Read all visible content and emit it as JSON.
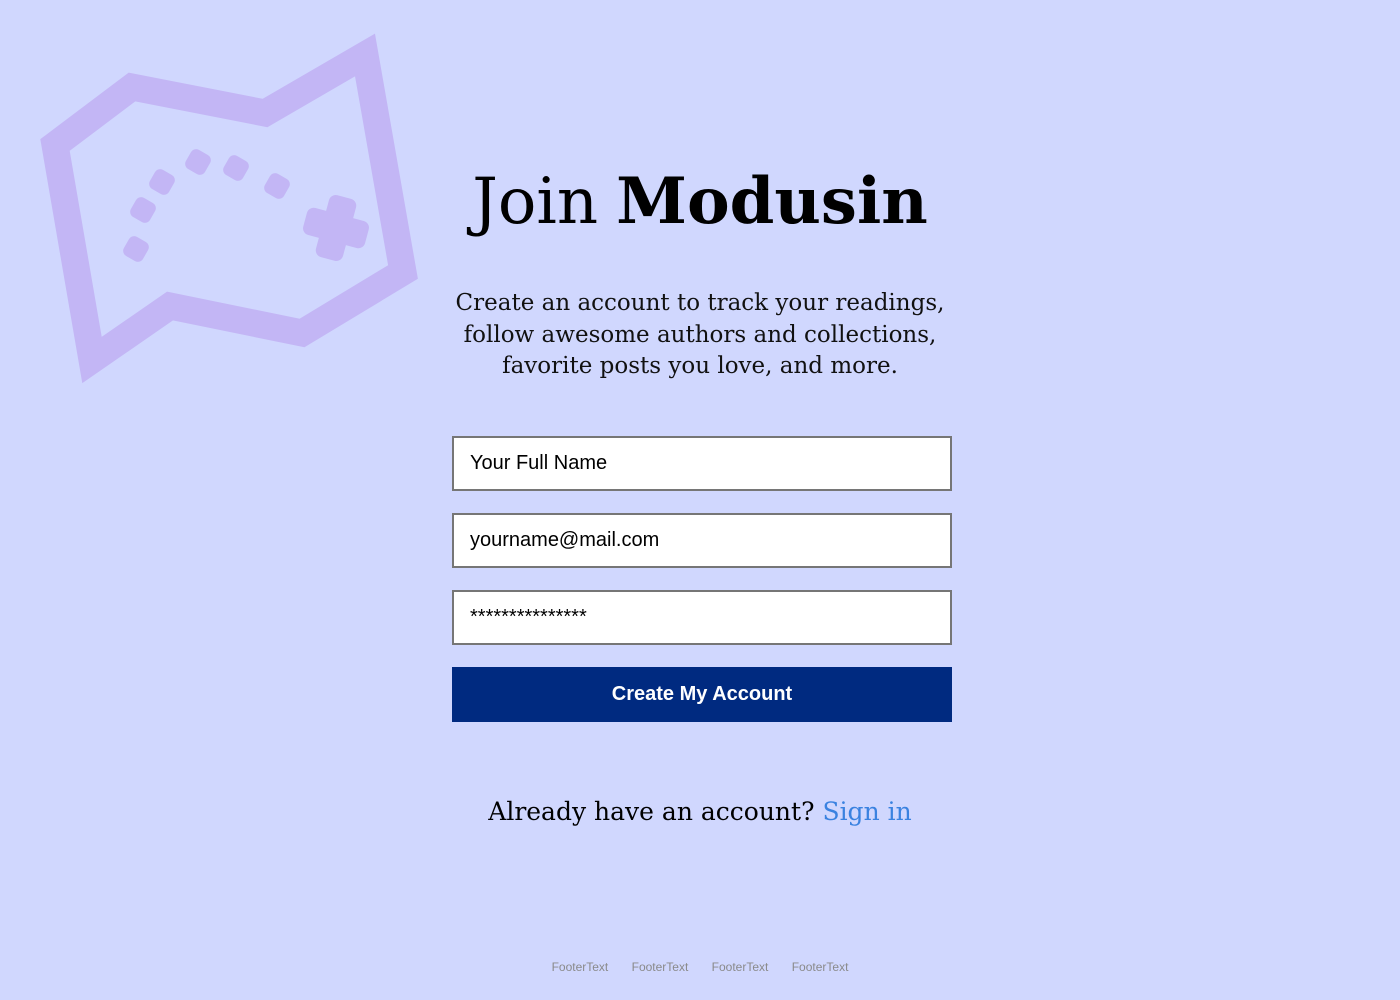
{
  "logo": {
    "icon": "gamepad-map-icon",
    "color": "#c3b6f5"
  },
  "title": {
    "join": "Join",
    "brand": "Modusin"
  },
  "subtitle": {
    "line1": "Create an account to track your readings,",
    "line2": "follow awesome authors and collections,",
    "line3": "favorite posts you love, and more."
  },
  "form": {
    "name": {
      "placeholder": "Your Full Name"
    },
    "email": {
      "placeholder": "yourname@mail.com"
    },
    "password": {
      "value": "***************"
    },
    "submit_label": "Create My Account"
  },
  "signin": {
    "prompt": "Already have an account?",
    "link_label": "Sign in"
  },
  "footer": {
    "links": [
      "FooterText",
      "FooterText",
      "FooterText",
      "FooterText"
    ]
  },
  "colors": {
    "background": "#d0d7fe",
    "button": "#002a80",
    "link": "#3a82e0",
    "logo": "#c3b6f5"
  }
}
